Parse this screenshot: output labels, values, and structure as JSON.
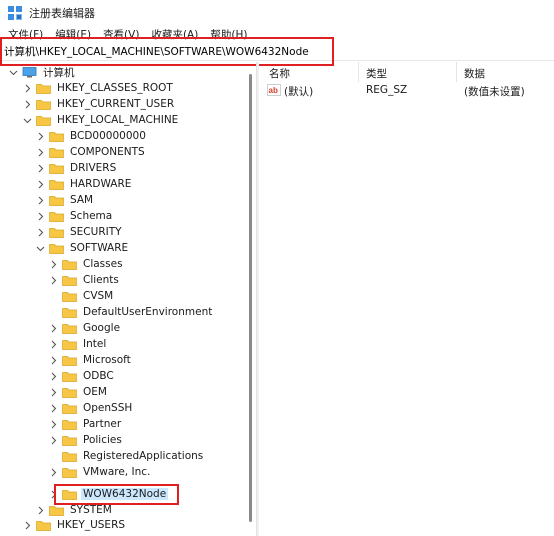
{
  "window": {
    "title": "注册表编辑器"
  },
  "menu": [
    {
      "label": "文件(F)"
    },
    {
      "label": "编辑(E)"
    },
    {
      "label": "查看(V)"
    },
    {
      "label": "收藏夹(A)"
    },
    {
      "label": "帮助(H)"
    }
  ],
  "address": {
    "value": "计算机\\HKEY_LOCAL_MACHINE\\SOFTWARE\\WOW6432Node"
  },
  "tree": {
    "root": "计算机",
    "hkcr": "HKEY_CLASSES_ROOT",
    "hkcu": "HKEY_CURRENT_USER",
    "hklm": "HKEY_LOCAL_MACHINE",
    "hklm_children": [
      "BCD00000000",
      "COMPONENTS",
      "DRIVERS",
      "HARDWARE",
      "SAM",
      "Schema",
      "SECURITY",
      "SOFTWARE"
    ],
    "software_children": [
      "Classes",
      "Clients",
      "CVSM",
      "DefaultUserEnvironment",
      "Google",
      "Intel",
      "Microsoft",
      "ODBC",
      "OEM",
      "OpenSSH",
      "Partner",
      "Policies",
      "RegisteredApplications",
      "VMware, Inc.",
      "WOW6432Node"
    ],
    "system": "SYSTEM",
    "hku": "HKEY_USERS"
  },
  "list": {
    "columns": {
      "name": "名称",
      "type": "类型",
      "data": "数据"
    },
    "rows": [
      {
        "name": "(默认)",
        "type": "REG_SZ",
        "data": "(数值未设置)"
      }
    ]
  },
  "colors": {
    "highlight_border": "#e02020",
    "selection": "#cce8ff",
    "folder": "#f6c644"
  }
}
